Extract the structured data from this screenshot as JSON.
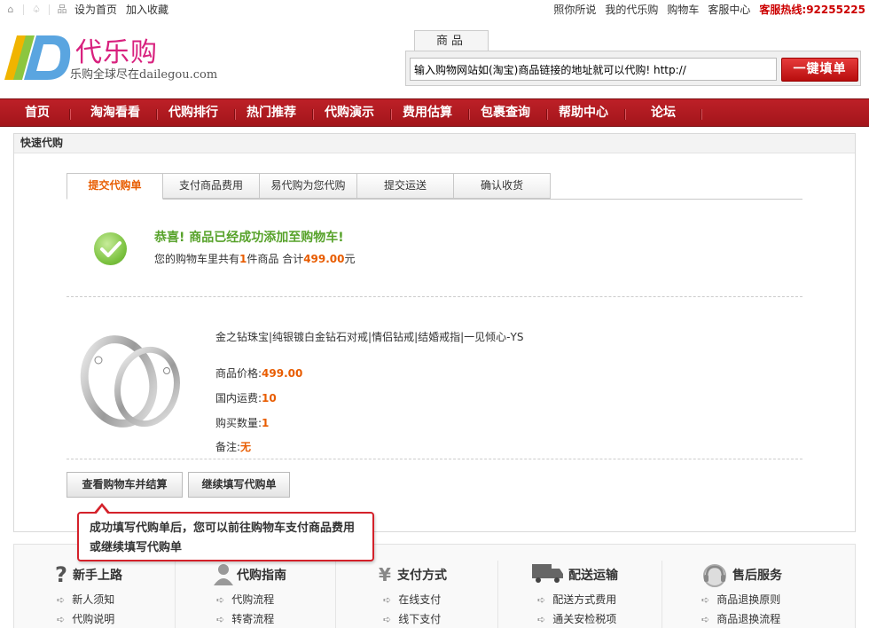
{
  "topbar": {
    "home_icon": "home-icon",
    "fav_icon": "favorite-icon",
    "org_icon": "sitemap-icon",
    "set_home": "设为首页",
    "add_fav": "加入收藏",
    "links": [
      "照你所说",
      "我的代乐购",
      "购物车",
      "客服中心"
    ],
    "hotline_label": "客服热线:",
    "hotline_number": "92255225"
  },
  "logo": {
    "brand": "代乐购",
    "slogan": "乐购全球尽在dailegou.com"
  },
  "search": {
    "tab": "商品",
    "value": "输入购物网站如(淘宝)商品链接的地址就可以代购! http://",
    "button": "一键填单"
  },
  "nav": {
    "items": [
      "首页",
      "淘淘看看",
      "代购排行",
      "热门推荐",
      "代购演示",
      "费用估算",
      "包裹查询",
      "帮助中心",
      "论坛"
    ]
  },
  "panel": {
    "title": "快速代购",
    "steps": [
      "提交代购单",
      "支付商品费用",
      "易代购为您代购",
      "提交运送",
      "确认收货"
    ],
    "active_step": 0
  },
  "success": {
    "title": "恭喜! 商品已经成功添加至购物车!",
    "prefix": "您的购物车里共有",
    "count": "1",
    "middle": "件商品 合计",
    "total": "499.00",
    "suffix": "元"
  },
  "product": {
    "name": "金之钻珠宝|纯银镀白金钻石对戒|情侣钻戒|结婚戒指|一见倾心-YS",
    "price_label": "商品价格:",
    "price": "499.00",
    "shipping_label": "国内运费:",
    "shipping": "10",
    "qty_label": "购买数量:",
    "qty": "1",
    "note_label": "备注:",
    "note": "无"
  },
  "buttons": {
    "checkout": "查看购物车并结算",
    "continue": "继续填写代购单"
  },
  "tip": {
    "text": "成功填写代购单后，您可以前往购物车支付商品费用或继续填写代购单"
  },
  "help": [
    {
      "icon": "question-icon",
      "title": "新手上路",
      "links": [
        "新人须知",
        "代购说明"
      ]
    },
    {
      "icon": "person-icon",
      "title": "代购指南",
      "links": [
        "代购流程",
        "转寄流程"
      ]
    },
    {
      "icon": "yen-icon",
      "title": "支付方式",
      "links": [
        "在线支付",
        "线下支付"
      ]
    },
    {
      "icon": "truck-icon",
      "title": "配送运输",
      "links": [
        "配送方式费用",
        "通关安检税项"
      ]
    },
    {
      "icon": "headset-icon",
      "title": "售后服务",
      "links": [
        "商品退换原则",
        "商品退换流程"
      ]
    }
  ],
  "colors": {
    "brand": "#d8217e",
    "nav_red": "#b31b21",
    "accent_orange": "#e85c00",
    "success_green": "#57a22a"
  }
}
